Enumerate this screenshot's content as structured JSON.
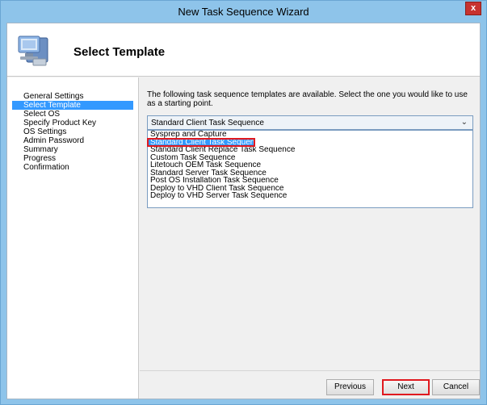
{
  "window": {
    "title": "New Task Sequence Wizard",
    "close_label": "x"
  },
  "header": {
    "title": "Select Template",
    "icon": "computer-wizard-icon"
  },
  "nav": {
    "items": [
      {
        "label": "General Settings",
        "selected": false
      },
      {
        "label": "Select Template",
        "selected": true
      },
      {
        "label": "Select OS",
        "selected": false
      },
      {
        "label": "Specify Product Key",
        "selected": false
      },
      {
        "label": "OS Settings",
        "selected": false
      },
      {
        "label": "Admin Password",
        "selected": false
      },
      {
        "label": "Summary",
        "selected": false
      },
      {
        "label": "Progress",
        "selected": false
      },
      {
        "label": "Confirmation",
        "selected": false
      }
    ]
  },
  "content": {
    "instructions": "The following task sequence templates are available.  Select the one you would like to use as a starting point.",
    "combo_value": "Standard Client Task Sequence",
    "options": [
      {
        "label": "Sysprep and Capture",
        "selected": false
      },
      {
        "label": "Standard Client Task Sequence",
        "selected": true
      },
      {
        "label": "Standard Client Replace Task Sequence",
        "selected": false
      },
      {
        "label": "Custom Task Sequence",
        "selected": false
      },
      {
        "label": "Litetouch OEM Task Sequence",
        "selected": false
      },
      {
        "label": "Standard Server Task Sequence",
        "selected": false
      },
      {
        "label": "Post OS Installation Task Sequence",
        "selected": false
      },
      {
        "label": "Deploy to VHD Client Task Sequence",
        "selected": false
      },
      {
        "label": "Deploy to VHD Server Task Sequence",
        "selected": false
      }
    ]
  },
  "buttons": {
    "previous": "Previous",
    "next": "Next",
    "cancel": "Cancel"
  },
  "colors": {
    "title_bar": "#8ec4ea",
    "selection": "#3399ff",
    "highlight_outline": "#e0191f"
  }
}
